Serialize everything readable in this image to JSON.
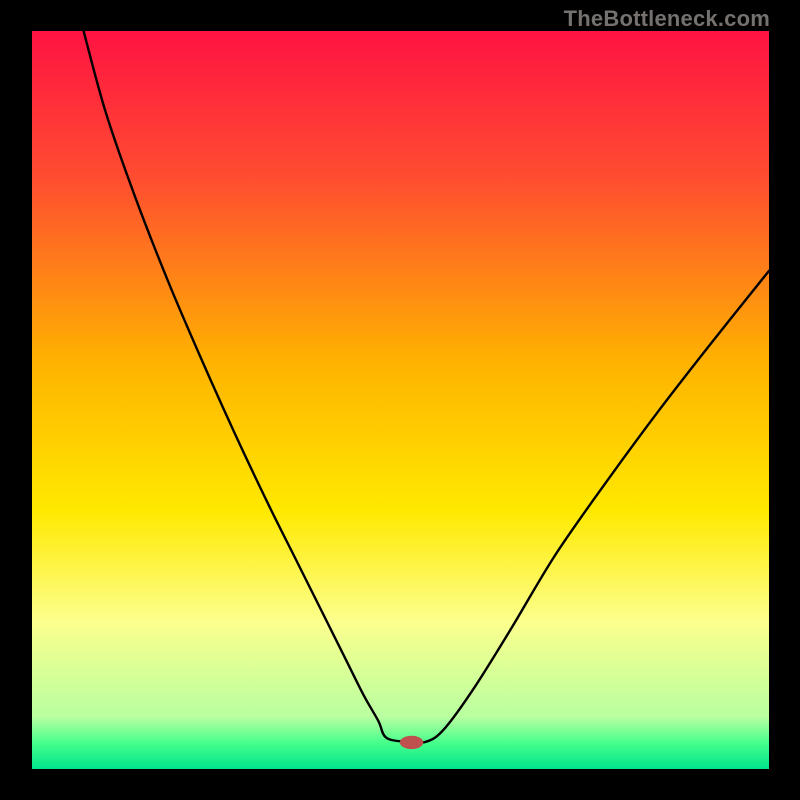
{
  "watermark": {
    "text": "TheBottleneck.com"
  },
  "chart_data": {
    "type": "line",
    "title": "",
    "xlabel": "",
    "ylabel": "",
    "xlim": [
      0,
      100
    ],
    "ylim": [
      0,
      100
    ],
    "grid": false,
    "legend": false,
    "background_gradient_stops": [
      {
        "offset": 0.0,
        "color": "#ff1342"
      },
      {
        "offset": 0.2,
        "color": "#ff4d30"
      },
      {
        "offset": 0.45,
        "color": "#ffb300"
      },
      {
        "offset": 0.65,
        "color": "#ffe900"
      },
      {
        "offset": 0.8,
        "color": "#fcff8d"
      },
      {
        "offset": 0.93,
        "color": "#b8ffa0"
      },
      {
        "offset": 0.965,
        "color": "#45ff8c"
      },
      {
        "offset": 1.0,
        "color": "#00e48b"
      }
    ],
    "series": [
      {
        "name": "curve",
        "x": [
          7.0,
          10.0,
          14.0,
          18.5,
          23.0,
          27.5,
          32.0,
          36.0,
          39.5,
          42.5,
          45.0,
          47.0,
          48.0,
          50.5,
          53.5,
          56.0,
          60.0,
          65.0,
          71.0,
          78.0,
          85.0,
          92.0,
          100.0
        ],
        "y": [
          100.0,
          89.0,
          77.5,
          66.0,
          55.5,
          45.5,
          36.0,
          28.0,
          21.0,
          15.0,
          10.0,
          6.5,
          4.3,
          3.7,
          3.7,
          5.5,
          11.0,
          19.0,
          29.0,
          39.0,
          48.5,
          57.5,
          67.5
        ]
      }
    ],
    "marker": {
      "x": 51.5,
      "y": 3.6,
      "rx": 1.6,
      "ry": 0.9,
      "color": "#c0504d"
    }
  }
}
